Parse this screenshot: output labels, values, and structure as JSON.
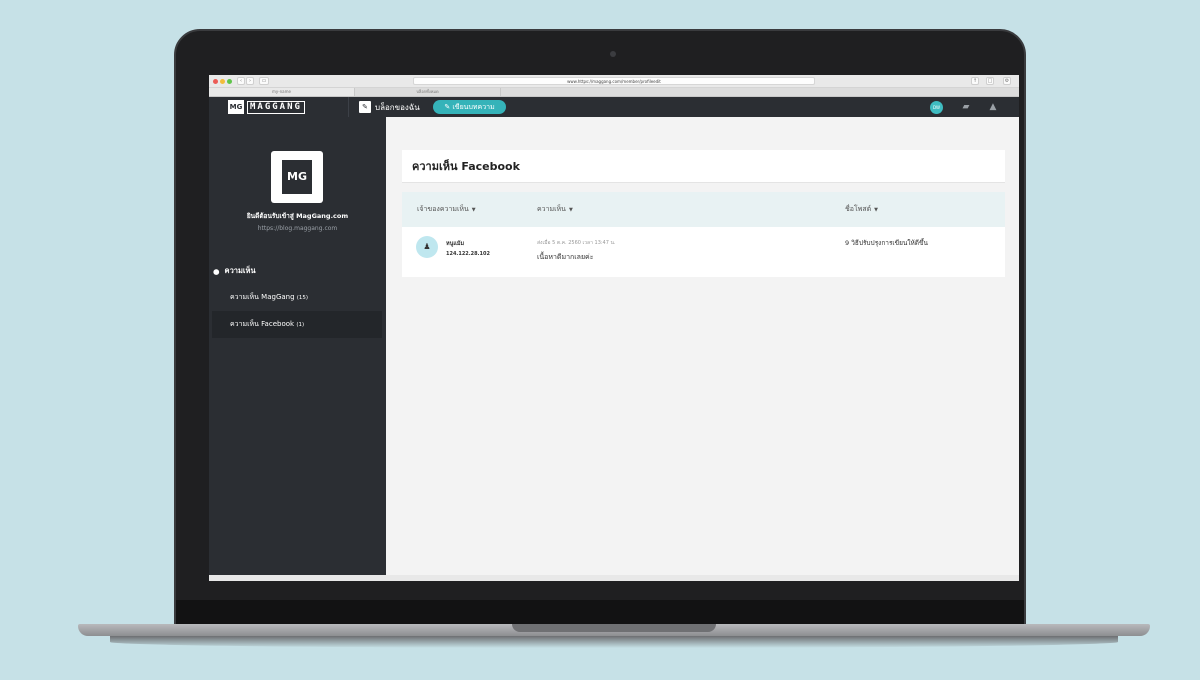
{
  "browser": {
    "url": "www.https://maggang.com/member/profileedit",
    "tabs": [
      "my-name",
      "บล็อกทั้งหมด"
    ]
  },
  "header": {
    "logo_mark": "MG",
    "logo_text": "MAGGANG",
    "myblog_label": "บล็อกของฉัน",
    "write_label": "เขียนบทความ",
    "avatar_initials": "DW"
  },
  "sidebar": {
    "profile_mark": "MG",
    "welcome": "ยินดีต้อนรับเข้าสู่ MagGang.com",
    "site_url": "https://blog.maggang.com",
    "section_title": "ความเห็น",
    "items": [
      {
        "label": "ความเห็น MagGang",
        "count": "(15)"
      },
      {
        "label": "ความเห็น Facebook",
        "count": "(1)"
      }
    ]
  },
  "main": {
    "title": "ความเห็น Facebook",
    "columns": [
      "เจ้าของความเห็น",
      "ความเห็น",
      "ชื่อโพสต์"
    ],
    "rows": [
      {
        "name": "หนูแม้ม",
        "ip": "124.122.28.102",
        "date": "ส่งเมื่อ 5 ต.ค. 2560 เวลา 13:47 น.",
        "comment": "เนื้อหาดีมากเลยค่ะ",
        "post": "9 วิธีปรับปรุงการเขียนให้ดีขึ้น"
      }
    ]
  }
}
